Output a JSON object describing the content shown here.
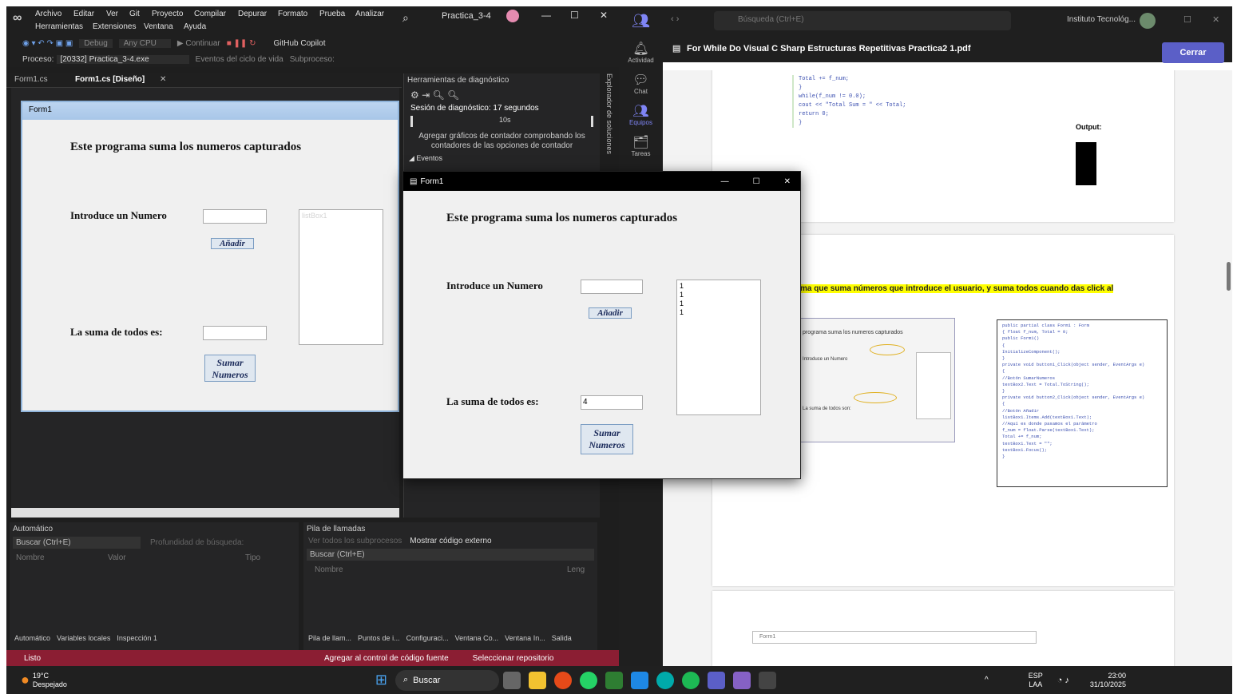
{
  "vs": {
    "menu": [
      "Archivo",
      "Editar",
      "Ver",
      "Git",
      "Proyecto",
      "Compilar",
      "Depurar",
      "Formato",
      "Prueba",
      "Analizar"
    ],
    "menu2": [
      "Herramientas",
      "Extensiones",
      "Ventana",
      "Ayuda"
    ],
    "search_icon_glyph": "⌕",
    "project_title": "Practica_3-4",
    "toolbar1": [
      "Debug",
      "Any CPU",
      "▶ Continuar",
      "GitHub Copilot"
    ],
    "process_label": "Proceso:",
    "process_value": "[20332] Practica_3-4.exe",
    "lifecycle": "Eventos del ciclo de vida",
    "subprocess": "Subproceso:",
    "tabs": [
      "Form1.cs",
      "Form1.cs [Diseño]"
    ],
    "designer_form": {
      "title": "Form1",
      "heading": "Este programa suma los numeros capturados",
      "input_label": "Introduce un Numero",
      "add_button": "Añadir",
      "listbox_label": "listBox1",
      "sum_label": "La suma de todos es:",
      "sum_button_line1": "Sumar",
      "sum_button_line2": "Numeros"
    },
    "diag": {
      "title": "Herramientas de diagnóstico",
      "session": "Sesión de diagnóstico: 17 segundos",
      "tick": "10s",
      "hint": "Agregar gráficos de contador comprobando los contadores de las opciones de contador",
      "events": "◢ Eventos"
    },
    "side_tab": "Explorador de soluciones",
    "auto_panel": {
      "title": "Automático",
      "search": "Buscar (Ctrl+E)",
      "depth": "Profundidad de búsqueda:",
      "cols": [
        "Nombre",
        "Valor",
        "Tipo"
      ],
      "tabs": [
        "Automático",
        "Variables locales",
        "Inspección 1"
      ]
    },
    "stack_panel": {
      "title": "Pila de llamadas",
      "threads": "Ver todos los subprocesos",
      "external": "Mostrar código externo",
      "search": "Buscar (Ctrl+E)",
      "cols": [
        "Nombre",
        "Leng"
      ],
      "tabs": [
        "Pila de llam...",
        "Puntos de i...",
        "Configuraci...",
        "Ventana Co...",
        "Ventana In...",
        "Salida"
      ]
    },
    "status": {
      "ready": "Listo",
      "source_control": "Agregar al control de código fuente",
      "repo": "Seleccionar repositorio"
    }
  },
  "teams": {
    "search_placeholder": "Búsqueda (Ctrl+E)",
    "org": "Instituto Tecnológ...",
    "rail": [
      "Actividad",
      "Chat",
      "Equipos",
      "Tareas"
    ],
    "pdf_title": "For While Do Visual C Sharp Estructuras Repetitivas Practica2 1.pdf",
    "close_button": "Cerrar",
    "code_lines": [
      "Total += f_num;",
      "}",
      "while(f_num != 0.0);",
      "cout << \"Total Sum = \" << Total;",
      "return 0;",
      "}"
    ],
    "output_label": "Output:",
    "highlight": "ma que suma números que introduce el usuario, y suma todos cuando das click al",
    "thumb_heading": "programa suma los numeros capturados",
    "thumb_input": "Introduce un Numero",
    "thumb_sum": "La suma de todos son:",
    "code2": [
      "public partial class Form1 : Form",
      "{   float f_num, Total = 0;",
      "    public Form1()",
      "    {",
      "        InitializeComponent();",
      "    }",
      "private void button1_Click(object sender, EventArgs e)",
      "{",
      "    //Botón SumarNumeros",
      "    textBox2.Text = Total.ToString();",
      "}",
      "private void button2_Click(object sender, EventArgs e)",
      "{",
      "    //Botón Añadir",
      "    listBox1.Items.Add(textBox1.Text);",
      "    //Aquí es donde pasamos el parámetro",
      "    f_num = float.Parse(textBox1.Text);",
      "    Total += f_num;",
      "    textBox1.Text = \"\";",
      "    textBox1.Focus();",
      "}"
    ],
    "page_footer": "Form1"
  },
  "form1": {
    "title": "Form1",
    "heading": "Este programa suma los numeros capturados",
    "input_label": "Introduce un Numero",
    "input_value": "",
    "add_button": "Añadir",
    "list_items": [
      "1",
      "1",
      "1",
      "1"
    ],
    "sum_label": "La suma de todos es:",
    "sum_value": "4",
    "sum_button_line1": "Sumar",
    "sum_button_line2": "Numeros"
  },
  "taskbar": {
    "temp": "19°C",
    "weather": "Despejado",
    "search": "Buscar",
    "lang1": "ESP",
    "lang2": "LAA",
    "time": "23:00",
    "date": "31/10/2025"
  }
}
